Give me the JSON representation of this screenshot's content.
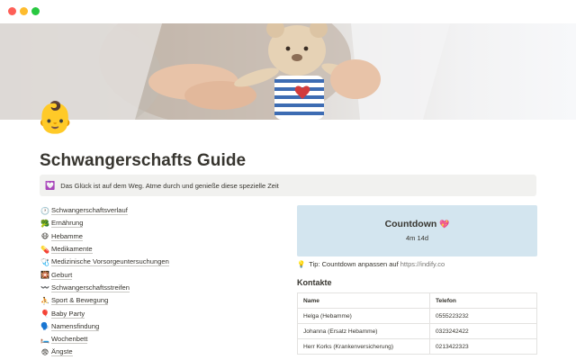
{
  "window": {
    "buttons": [
      "close",
      "minimize",
      "maximize"
    ]
  },
  "cover": {
    "icon": "baby-emoji-icon"
  },
  "page": {
    "icon": "👶",
    "title": "Schwangerschafts Guide"
  },
  "callout": {
    "icon": "💟",
    "text": "Das Glück ist auf dem Weg. Atme durch und genieße diese spezielle Zeit"
  },
  "links": [
    {
      "icon": "🕐",
      "label": "Schwangerschaftsverlauf"
    },
    {
      "icon": "🥦",
      "label": "Ernährung"
    },
    {
      "icon": "😷",
      "label": "Hebamme"
    },
    {
      "icon": "💊",
      "label": "Medikamente"
    },
    {
      "icon": "🩺",
      "label": "Medizinische Vorsorgeuntersuchungen"
    },
    {
      "icon": "🎇",
      "label": "Geburt"
    },
    {
      "icon": "〰️",
      "label": "Schwangerschaftsstreifen"
    },
    {
      "icon": "⛹️",
      "label": "Sport & Bewegung"
    },
    {
      "icon": "🎈",
      "label": "Baby Party"
    },
    {
      "icon": "🗣️",
      "label": "Namensfindung"
    },
    {
      "icon": "🛏️",
      "label": "Wochenbett"
    },
    {
      "icon": "😨",
      "label": "Ängste"
    }
  ],
  "countdown": {
    "title": "Countdown",
    "title_icon": "💖",
    "value": "4m 14d"
  },
  "tip": {
    "icon": "💡",
    "text": "Tip: Countdown anpassen auf",
    "link": "https://indify.co"
  },
  "contacts": {
    "heading": "Kontakte",
    "columns": [
      "Name",
      "Telefon"
    ],
    "rows": [
      [
        "Helga (Hebamme)",
        "0555223232"
      ],
      [
        "Johanna (Ersatz Hebamme)",
        "0323242422"
      ],
      [
        "Herr Korks (Krankenversicherung)",
        "0213422323"
      ]
    ]
  },
  "colors": {
    "callout_bg": "#f1f1ef",
    "countdown_bg": "#d3e5ef",
    "text": "#37352f",
    "border": "#e3e2e0"
  }
}
